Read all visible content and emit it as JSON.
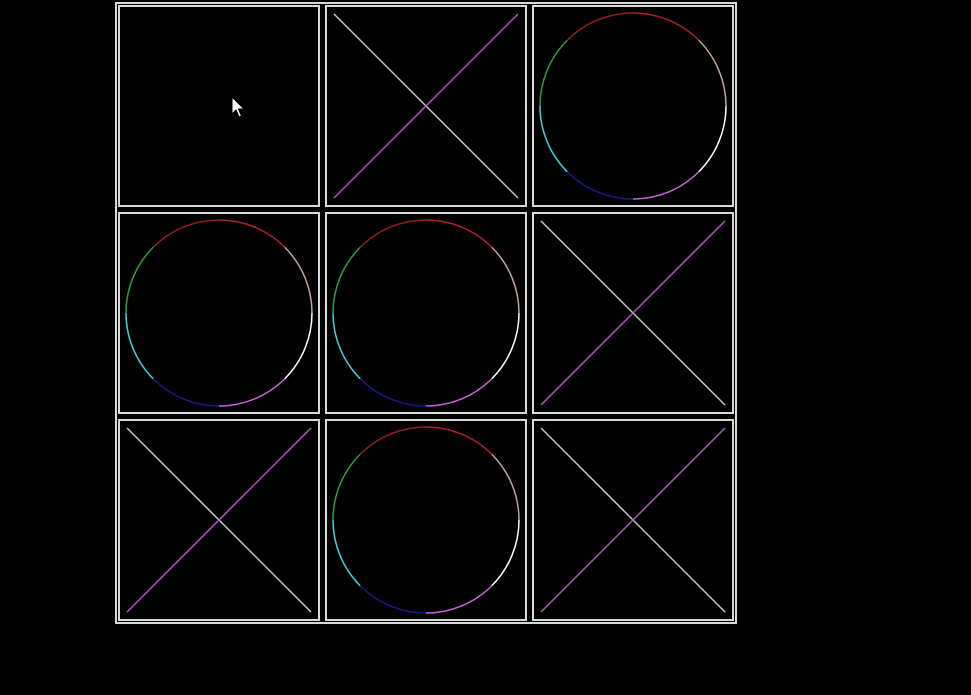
{
  "board": {
    "rows": 3,
    "cols": 3,
    "cells": [
      "",
      "X",
      "O",
      "O",
      "O",
      "X",
      "X",
      "O",
      "X"
    ]
  },
  "colors": {
    "grid": "#d8d8d8",
    "x_stroke_a": "#c8c8c8",
    "x_stroke_b": "#b455c8",
    "o_arc": [
      "#b02020",
      "#d0a090",
      "#ffffff",
      "#d060e0",
      "#1a1a8c",
      "#40d0e0",
      "#30a030",
      "#902020"
    ]
  },
  "icons": {
    "x_mark": "x-mark-icon",
    "o_mark": "o-mark-icon",
    "cursor": "mouse-pointer-icon"
  }
}
